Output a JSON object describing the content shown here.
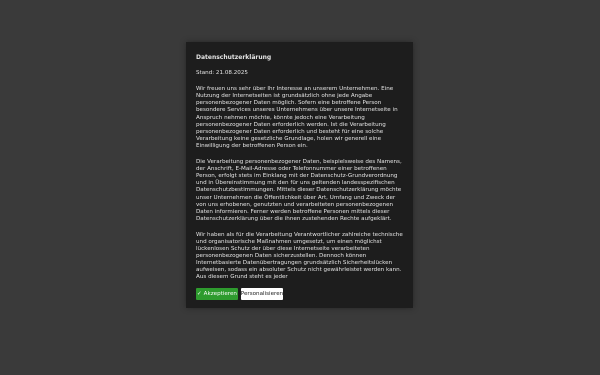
{
  "dialog": {
    "title": "Datenschutzerklärung",
    "stand": "Stand: 21.08.2025",
    "paragraphs": [
      "Wir freuen uns sehr über Ihr Interesse an unserem Unternehmen. Eine Nutzung der Internetseiten ist grundsätzlich ohne jede Angabe personenbezogener Daten möglich. Sofern eine betroffene Person besondere Services unseres Unternehmens über unsere Internetseite in Anspruch nehmen möchte, könnte jedoch eine Verarbeitung personenbezogener Daten erforderlich werden. Ist die Verarbeitung personenbezogener Daten erforderlich und besteht für eine solche Verarbeitung keine gesetzliche Grundlage, holen wir generell eine Einwilligung der betroffenen Person ein.",
      "Die Verarbeitung personenbezogener Daten, beispielsweise des Namens, der Anschrift, E-Mail-Adresse oder Telefonnummer einer betroffenen Person, erfolgt stets im Einklang mit der Datenschutz-Grundverordnung und in Übereinstimmung mit den für uns geltenden landesspezifischen Datenschutzbestimmungen. Mittels dieser Datenschutzerklärung möchte unser Unternehmen die Öffentlichkeit über Art, Umfang und Zweck der von uns erhobenen, genutzten und verarbeiteten personenbezogenen Daten informieren. Ferner werden betroffene Personen mittels dieser Datenschutzerklärung über die ihnen zustehenden Rechte aufgeklärt.",
      "Wir haben als für die Verarbeitung Verantwortlicher zahlreiche technische und organisatorische Maßnahmen umgesetzt, um einen möglichst lückenlosen Schutz der über diese Internetseite verarbeiteten personenbezogenen Daten sicherzustellen. Dennoch können Internetbasierte Datenübertragungen grundsätzlich Sicherheitslücken aufweisen, sodass ein absoluter Schutz nicht gewährleistet werden kann. Aus diesem Grund steht es jeder"
    ],
    "accept_label": "Akzeptieren",
    "accept_icon": "check-icon",
    "personalize_label": "Personalisieren"
  },
  "colors": {
    "background": "#3a3a3a",
    "dialog": "#1d1d1d",
    "accept": "#2e9b2e"
  }
}
